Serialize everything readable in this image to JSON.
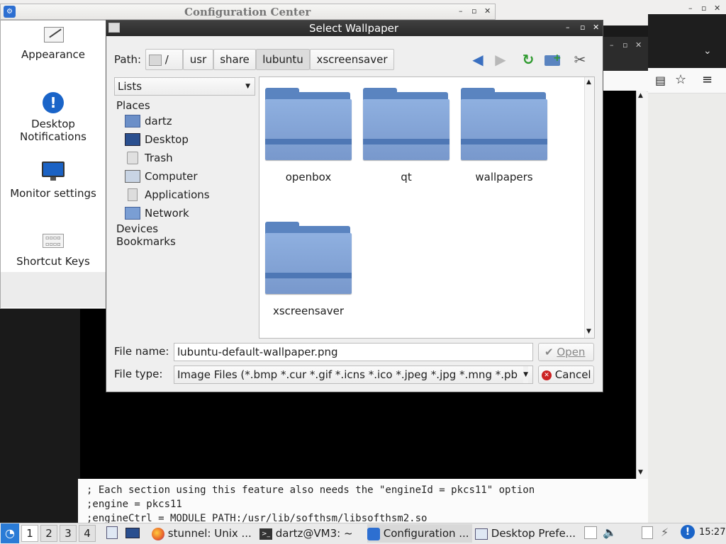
{
  "config_center": {
    "title": "Configuration Center",
    "items": [
      "Appearance",
      "Desktop Notifications",
      "Monitor settings",
      "Shortcut Keys"
    ],
    "controls": [
      "–",
      "▫",
      "✕"
    ]
  },
  "dialog": {
    "title": "Select Wallpaper",
    "path_label": "Path:",
    "path_segments": [
      "/",
      "usr",
      "share",
      "lubuntu",
      "xscreensaver"
    ],
    "view_mode": "Lists",
    "places_header": "Places",
    "places": [
      "dartz",
      "Desktop",
      "Trash",
      "Computer",
      "Applications",
      "Network"
    ],
    "devices_header": "Devices",
    "bookmarks_header": "Bookmarks",
    "folders": [
      "openbox",
      "qt",
      "wallpapers",
      "xscreensaver"
    ],
    "file_name_label": "File name:",
    "file_name_value": "lubuntu-default-wallpaper.png",
    "file_type_label": "File type:",
    "file_type_value": "Image Files (*.bmp *.cur *.gif *.icns *.ico *.jpeg *.jpg *.mng *.pb",
    "open_button": "Open",
    "cancel_button": "Cancel"
  },
  "terminal": {
    "lines": [
      "; Each section using this feature also needs the \"engineId = pkcs11\" option",
      ";engine = pkcs11",
      ";engineCtrl = MODULE_PATH:/usr/lib/softhsm/libsofthsm2.so"
    ]
  },
  "taskbar": {
    "workspaces": [
      "1",
      "2",
      "3",
      "4"
    ],
    "tasks": [
      "stunnel: Unix ...",
      "dartz@VM3: ~",
      "Configuration ...",
      "Desktop Prefe..."
    ],
    "clock": "15:27"
  },
  "colors": {
    "folder_blue": "#7898cc",
    "titlebar_dark": "#2a2a2a",
    "cancel_red": "#cc2222"
  }
}
